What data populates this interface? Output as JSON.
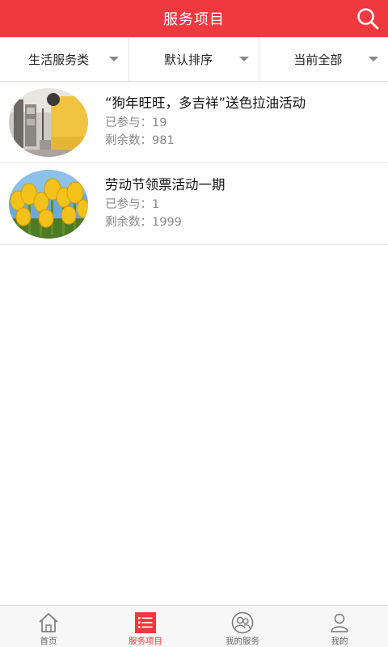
{
  "header": {
    "title": "服务项目"
  },
  "filters": [
    {
      "label": "生活服务类"
    },
    {
      "label": "默认排序"
    },
    {
      "label": "当前全部"
    }
  ],
  "items": [
    {
      "title": "“狗年旺旺，多吉祥”送色拉油活动",
      "joined": "已参与：19",
      "remaining": "剩余数：981",
      "image": "photo-studio"
    },
    {
      "title": "劳动节领票活动一期",
      "joined": "已参与：1",
      "remaining": "剩余数：1999",
      "image": "yellow-tulips"
    }
  ],
  "tabbar": [
    {
      "label": "首页",
      "icon": "home-icon",
      "active": false
    },
    {
      "label": "服务项目",
      "icon": "list-icon",
      "active": true
    },
    {
      "label": "我的服务",
      "icon": "users-icon",
      "active": false
    },
    {
      "label": "我的",
      "icon": "user-icon",
      "active": false
    }
  ],
  "colors": {
    "accent": "#f0393f",
    "text": "#222222",
    "muted": "#888888"
  }
}
